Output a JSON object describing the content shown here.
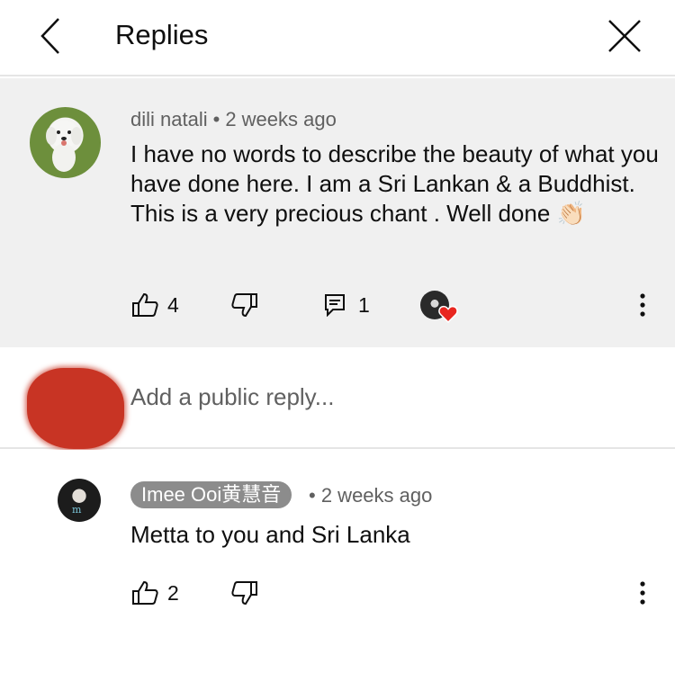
{
  "header": {
    "title": "Replies",
    "back_icon": "chevron-left-icon",
    "close_icon": "close-icon"
  },
  "parent_comment": {
    "author": "dili natali",
    "separator": "•",
    "time": "2 weeks ago",
    "text": "I have no words to describe the beauty of what you have done here. I am a Sri Lankan & a Buddhist. This is a very precious chant . Well done",
    "emoji": "👏🏻",
    "likes": "4",
    "replies": "1",
    "creator_hearted": true
  },
  "reply_input": {
    "placeholder": "Add a public reply..."
  },
  "reply_comment": {
    "author": "Imee Ooi黄慧音",
    "separator": "•",
    "time": "2 weeks ago",
    "text": "Metta to you and Sri Lanka",
    "likes": "2"
  },
  "colors": {
    "highlight_bg": "#f0f0f0",
    "heart": "#e8261f",
    "badge_bg": "#8c8c8c",
    "secondary_text": "#606060"
  }
}
